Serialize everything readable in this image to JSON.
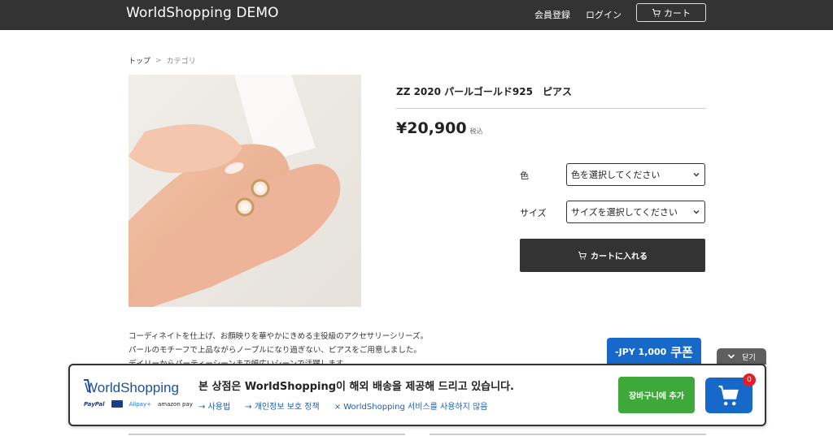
{
  "header": {
    "brand": "WorldShopping DEMO",
    "register": "会員登録",
    "login": "ログイン",
    "cart": "カート"
  },
  "breadcrumb": {
    "top": "トップ",
    "separator": ">",
    "category": "カテゴリ"
  },
  "product": {
    "title": "ZZ 2020 パールゴールド925　ピアス",
    "price": "¥20,900",
    "tax_note": "税込",
    "color_label": "色",
    "color_select": "色を選択してください",
    "size_label": "サイズ",
    "size_select": "サイズを選択してください",
    "add_to_cart": "カートに入れる",
    "description": [
      "コーディネイトを仕上げ、お顔映りを華やかにきめる主役級のアクセサリーシリーズ。",
      "パールのモチーフで上品ながらノーブルになり過ぎない、ピアスをご用意しました。",
      "デイリーからパーティーシーンまで幅広いシーンで活躍します。"
    ]
  },
  "coupon": {
    "amount": "-JPY 1,000",
    "word": "쿠폰"
  },
  "close_tab": {
    "label": "닫기"
  },
  "ws_banner": {
    "logo": "WorldShopping",
    "payments": [
      "PayPal",
      "Alipay+",
      "amazon pay"
    ],
    "heading": "본 상점은 WorldShopping이 해외 배송을 제공해 드리고 있습니다.",
    "links": [
      "→ 사용법",
      "→ 개인정보 보호 정책",
      "× WorldShopping 서비스를 사용하지 않음"
    ],
    "add_button": "장바구니에 추가",
    "cart_count": "0"
  },
  "colors": {
    "header_bg": "#333333",
    "button_dark": "#333333",
    "coupon_blue": "#1769c9",
    "green": "#3fa83a",
    "badge_red": "#e01f26"
  }
}
